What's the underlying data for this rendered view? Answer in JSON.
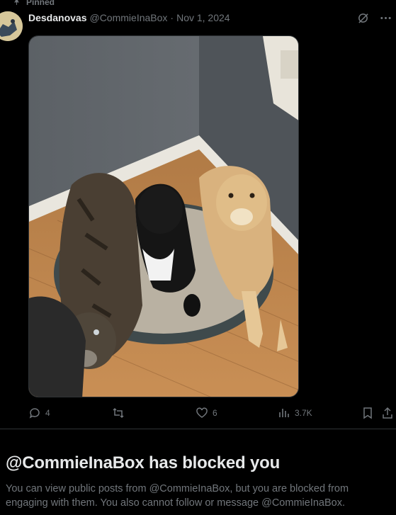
{
  "pinned": {
    "label": "Pinned"
  },
  "post": {
    "author_name": "Desdanovas",
    "handle": "@CommieInaBox",
    "separator": "·",
    "date": "Nov 1, 2024",
    "image_alt": "Three dogs on a dog bed in a corner of a room",
    "actions": {
      "replies": "4",
      "likes": "6",
      "views": "3.7K"
    }
  },
  "blocked": {
    "title": "@CommieInaBox has blocked you",
    "message": "You can view public posts from @CommieInaBox, but you are blocked from engaging with them. You also cannot follow or message @CommieInaBox."
  },
  "colors": {
    "background": "#000000",
    "text_primary": "#e7e9ea",
    "text_secondary": "#71767b",
    "border": "#2f3336"
  }
}
